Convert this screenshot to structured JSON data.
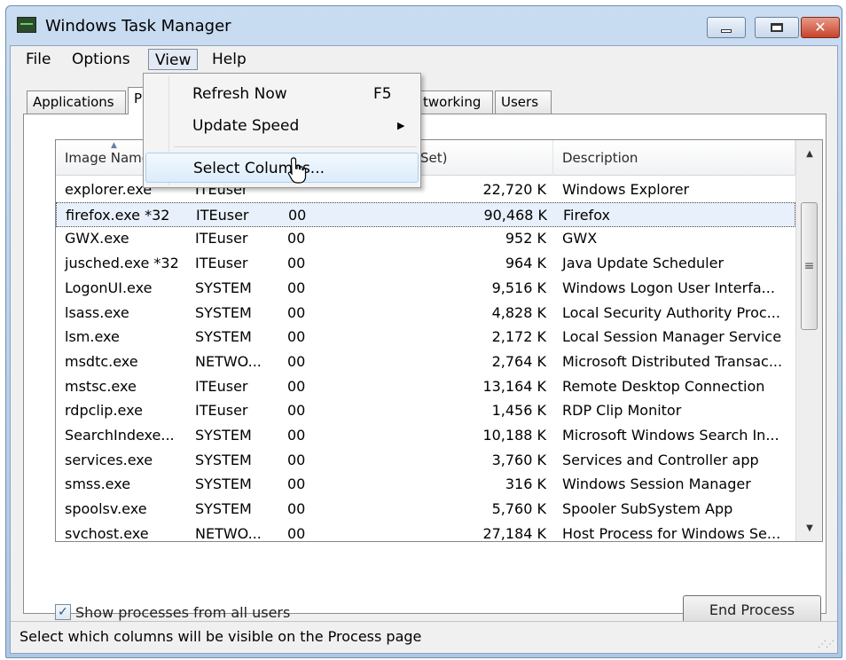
{
  "window": {
    "title": "Windows Task Manager",
    "close_glyph": "✕"
  },
  "menubar": {
    "items": [
      "File",
      "Options",
      "View",
      "Help"
    ],
    "open_menu": "View"
  },
  "view_menu": {
    "items": [
      {
        "label": "Refresh Now",
        "shortcut": "F5"
      },
      {
        "label": "Update Speed",
        "submenu_arrow": "▶"
      },
      {
        "label": "Select Columns..."
      }
    ]
  },
  "tabs": {
    "items": [
      "Applications",
      "P",
      "tworking",
      "Users"
    ]
  },
  "process_table": {
    "headers": [
      "Image Name",
      "",
      "",
      "ate Working Set)",
      "Description"
    ],
    "sort_glyph": "▲",
    "rows": [
      {
        "name": "explorer.exe",
        "user": "ITEuser",
        "cpu": "",
        "mem": "22,720 K",
        "desc": "Windows Explorer"
      },
      {
        "name": "firefox.exe *32",
        "user": "ITEuser",
        "cpu": "00",
        "mem": "90,468 K",
        "desc": "Firefox",
        "selected": true
      },
      {
        "name": "GWX.exe",
        "user": "ITEuser",
        "cpu": "00",
        "mem": "952 K",
        "desc": "GWX"
      },
      {
        "name": "jusched.exe *32",
        "user": "ITEuser",
        "cpu": "00",
        "mem": "964 K",
        "desc": "Java Update Scheduler"
      },
      {
        "name": "LogonUI.exe",
        "user": "SYSTEM",
        "cpu": "00",
        "mem": "9,516 K",
        "desc": "Windows Logon User Interfa..."
      },
      {
        "name": "lsass.exe",
        "user": "SYSTEM",
        "cpu": "00",
        "mem": "4,828 K",
        "desc": "Local Security Authority Proc..."
      },
      {
        "name": "lsm.exe",
        "user": "SYSTEM",
        "cpu": "00",
        "mem": "2,172 K",
        "desc": "Local Session Manager Service"
      },
      {
        "name": "msdtc.exe",
        "user": "NETWO...",
        "cpu": "00",
        "mem": "2,764 K",
        "desc": "Microsoft Distributed Transac..."
      },
      {
        "name": "mstsc.exe",
        "user": "ITEuser",
        "cpu": "00",
        "mem": "13,164 K",
        "desc": "Remote Desktop Connection"
      },
      {
        "name": "rdpclip.exe",
        "user": "ITEuser",
        "cpu": "00",
        "mem": "1,456 K",
        "desc": "RDP Clip Monitor"
      },
      {
        "name": "SearchIndexe...",
        "user": "SYSTEM",
        "cpu": "00",
        "mem": "10,188 K",
        "desc": "Microsoft Windows Search In..."
      },
      {
        "name": "services.exe",
        "user": "SYSTEM",
        "cpu": "00",
        "mem": "3,760 K",
        "desc": "Services and Controller app"
      },
      {
        "name": "smss.exe",
        "user": "SYSTEM",
        "cpu": "00",
        "mem": "316 K",
        "desc": "Windows Session Manager"
      },
      {
        "name": "spoolsv.exe",
        "user": "SYSTEM",
        "cpu": "00",
        "mem": "5,760 K",
        "desc": "Spooler SubSystem App"
      },
      {
        "name": "svchost.exe",
        "user": "NETWO...",
        "cpu": "00",
        "mem": "27,184 K",
        "desc": "Host Process for Windows Se..."
      }
    ],
    "scroll_up_glyph": "▲",
    "scroll_down_glyph": "▼",
    "thumb_grip": "≡"
  },
  "footer": {
    "show_all_label": "Show processes from all users",
    "show_all_checked": true,
    "check_glyph": "✓",
    "end_process_label": "End Process"
  },
  "statusbar": {
    "text": "Select which columns will be visible on the Process page",
    "grip": "⋰⋰"
  }
}
